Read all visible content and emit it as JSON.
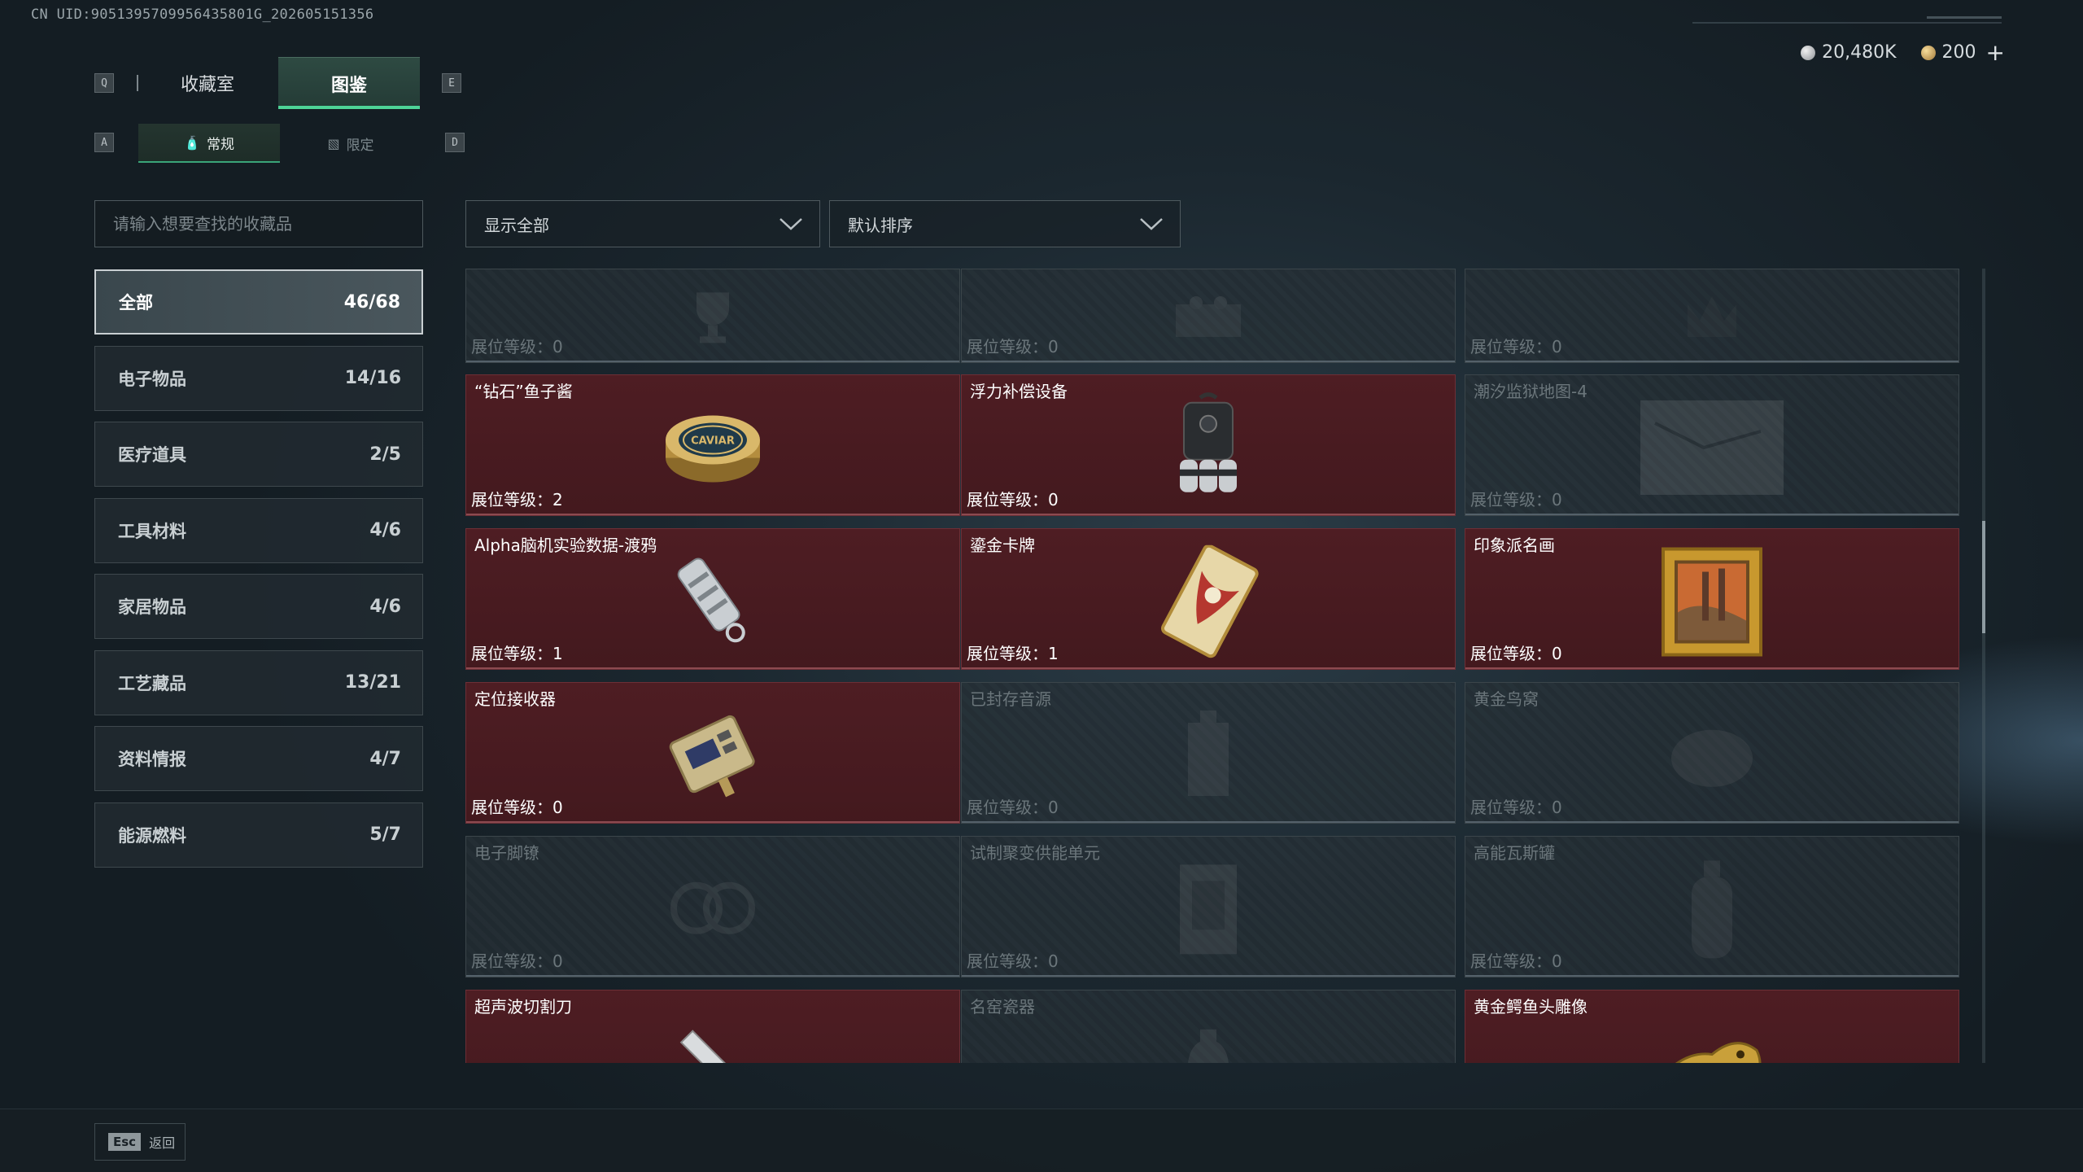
{
  "uid": "CN UID:9051395709956435801G_202605151356",
  "currency": {
    "silver": "20,480K",
    "gold": "200",
    "plus": "+"
  },
  "keys": {
    "prev_tab": "Q",
    "next_tab": "E",
    "prev_sub": "A",
    "next_sub": "D"
  },
  "tabs": [
    {
      "label": "收藏室"
    },
    {
      "label": "图鉴"
    }
  ],
  "subtabs": [
    {
      "label": "常规",
      "icon": "bottle-icon"
    },
    {
      "label": "限定",
      "icon": "image-icon"
    }
  ],
  "search": {
    "placeholder": "请输入想要查找的收藏品"
  },
  "categories": [
    {
      "label": "全部",
      "count": "46/68"
    },
    {
      "label": "电子物品",
      "count": "14/16"
    },
    {
      "label": "医疗道具",
      "count": "2/5"
    },
    {
      "label": "工具材料",
      "count": "4/6"
    },
    {
      "label": "家居物品",
      "count": "4/6"
    },
    {
      "label": "工艺藏品",
      "count": "13/21"
    },
    {
      "label": "资料情报",
      "count": "4/7"
    },
    {
      "label": "能源燃料",
      "count": "5/7"
    }
  ],
  "filters": {
    "show": "显示全部",
    "sort": "默认排序"
  },
  "level_prefix": "展位等级：",
  "items": [
    {
      "name": "",
      "level": "0",
      "owned": false,
      "icon": "trophy-icon"
    },
    {
      "name": "",
      "level": "0",
      "owned": false,
      "icon": "chess-icon"
    },
    {
      "name": "",
      "level": "0",
      "owned": false,
      "icon": "crown-icon"
    },
    {
      "name": "“钻石”鱼子酱",
      "level": "2",
      "owned": true,
      "icon": "caviar-tin-icon"
    },
    {
      "name": "浮力补偿设备",
      "level": "0",
      "owned": true,
      "icon": "buoyancy-device-icon"
    },
    {
      "name": "潮汐监狱地图-4",
      "level": "0",
      "owned": false,
      "icon": "map-icon"
    },
    {
      "name": "Alpha脑机实验数据-渡鸦",
      "level": "1",
      "owned": true,
      "icon": "data-drive-icon"
    },
    {
      "name": "鎏金卡牌",
      "level": "1",
      "owned": true,
      "icon": "gilded-card-icon"
    },
    {
      "name": "印象派名画",
      "level": "0",
      "owned": true,
      "icon": "painting-icon"
    },
    {
      "name": "定位接收器",
      "level": "0",
      "owned": true,
      "icon": "receiver-icon"
    },
    {
      "name": "已封存音源",
      "level": "0",
      "owned": false,
      "icon": "sealed-audio-icon"
    },
    {
      "name": "黄金鸟窝",
      "level": "0",
      "owned": false,
      "icon": "nest-icon"
    },
    {
      "name": "电子脚镣",
      "level": "0",
      "owned": false,
      "icon": "shackle-icon"
    },
    {
      "name": "试制聚变供能单元",
      "level": "0",
      "owned": false,
      "icon": "fusion-cell-icon"
    },
    {
      "name": "高能瓦斯罐",
      "level": "0",
      "owned": false,
      "icon": "gas-tank-icon"
    },
    {
      "name": "超声波切割刀",
      "level": "",
      "owned": true,
      "icon": "ultrasonic-knife-icon"
    },
    {
      "name": "名窑瓷器",
      "level": "",
      "owned": false,
      "icon": "porcelain-icon"
    },
    {
      "name": "黄金鳄鱼头雕像",
      "level": "",
      "owned": true,
      "icon": "croc-statue-icon"
    }
  ],
  "footer": {
    "esc_key": "Esc",
    "esc_label": "返回"
  }
}
